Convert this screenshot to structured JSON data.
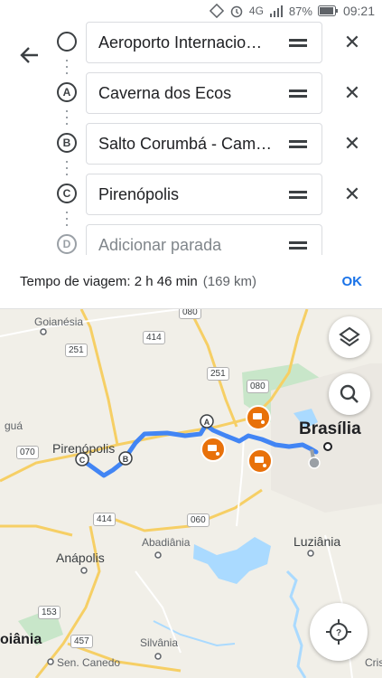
{
  "status_bar": {
    "network": "4G",
    "battery": "87%",
    "time": "09:21"
  },
  "stops": [
    {
      "marker": "",
      "label": "Aeroporto Internacio…",
      "placeholder": false
    },
    {
      "marker": "A",
      "label": "Caverna dos Ecos",
      "placeholder": false
    },
    {
      "marker": "B",
      "label": "Salto Corumbá - Cam…",
      "placeholder": false
    },
    {
      "marker": "C",
      "label": "Pirenópolis",
      "placeholder": false
    },
    {
      "marker": "D",
      "label": "Adicionar parada",
      "placeholder": true
    }
  ],
  "travel": {
    "label": "Tempo de viagem: 2 h 46 min",
    "distance": "(169 km)",
    "ok": "OK"
  },
  "map": {
    "cities": {
      "goianesia": "Goianésia",
      "brasilia": "Brasília",
      "pirenopolis": "Pirenópolis",
      "anapolis": "Anápolis",
      "abadiania": "Abadiânia",
      "luziania": "Luziânia",
      "silvania": "Silvânia",
      "sen_canedo": "Sen. Canedo",
      "goiania": "oiânia",
      "agua": "guá",
      "cris": "Cris"
    },
    "roads": {
      "r080a": "080",
      "r414a": "414",
      "r251a": "251",
      "r251b": "251",
      "r080b": "080",
      "r070": "070",
      "r414b": "414",
      "r060": "060",
      "r153": "153",
      "r457": "457"
    },
    "route_markers": {
      "a": "A",
      "b": "B",
      "c": "C"
    },
    "colors": {
      "route": "#4285f4",
      "camera_badge": "#e8710a",
      "water": "#aadaff",
      "park": "#c8e6c9"
    }
  }
}
